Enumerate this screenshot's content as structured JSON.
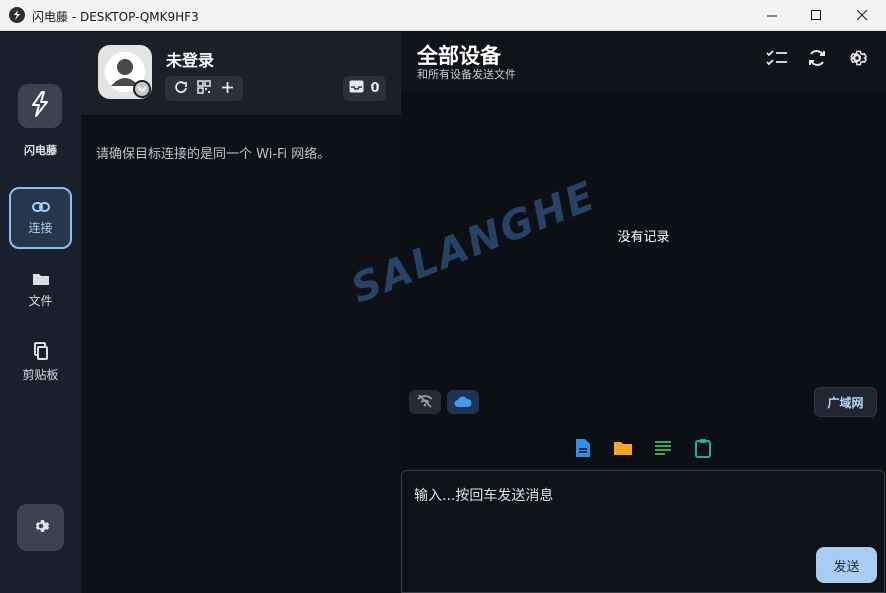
{
  "window": {
    "title": "闪电藤 - DESKTOP-QMK9HF3",
    "minimize_icon": "minimize-icon",
    "maximize_icon": "maximize-icon",
    "close_icon": "close-icon"
  },
  "sidebar": {
    "app_name": "闪电藤",
    "items": [
      {
        "label": "连接",
        "icon": "link-icon",
        "active": true
      },
      {
        "label": "文件",
        "icon": "folder-icon",
        "active": false
      },
      {
        "label": "剪贴板",
        "icon": "clipboard-copy-icon",
        "active": false
      }
    ],
    "settings_icon": "gear-icon"
  },
  "profile": {
    "username": "未登录",
    "inbox_count": "0",
    "actions": [
      "refresh-icon",
      "qr-code-icon",
      "plus-icon"
    ]
  },
  "connection": {
    "hint": "请确保目标连接的是同一个 Wi-Fi 网络。"
  },
  "devices": {
    "title": "全部设备",
    "subtitle": "和所有设备发送文件",
    "empty_text": "没有记录",
    "header_icons": [
      "checklist-icon",
      "sync-icon",
      "gear-icon"
    ],
    "wan_label": "广域网"
  },
  "composer": {
    "placeholder": "输入...按回车发送消息",
    "send_label": "发送",
    "tools": [
      "file-icon",
      "folder-icon",
      "text-icon",
      "clipboard-icon"
    ]
  },
  "watermark": "SALANGHE",
  "colors": {
    "accent": "#a8cdf3",
    "file_blue": "#2f8fe8",
    "folder_orange": "#f5a623",
    "text_green": "#3aa84f",
    "clipboard_teal": "#1bb3a0"
  }
}
